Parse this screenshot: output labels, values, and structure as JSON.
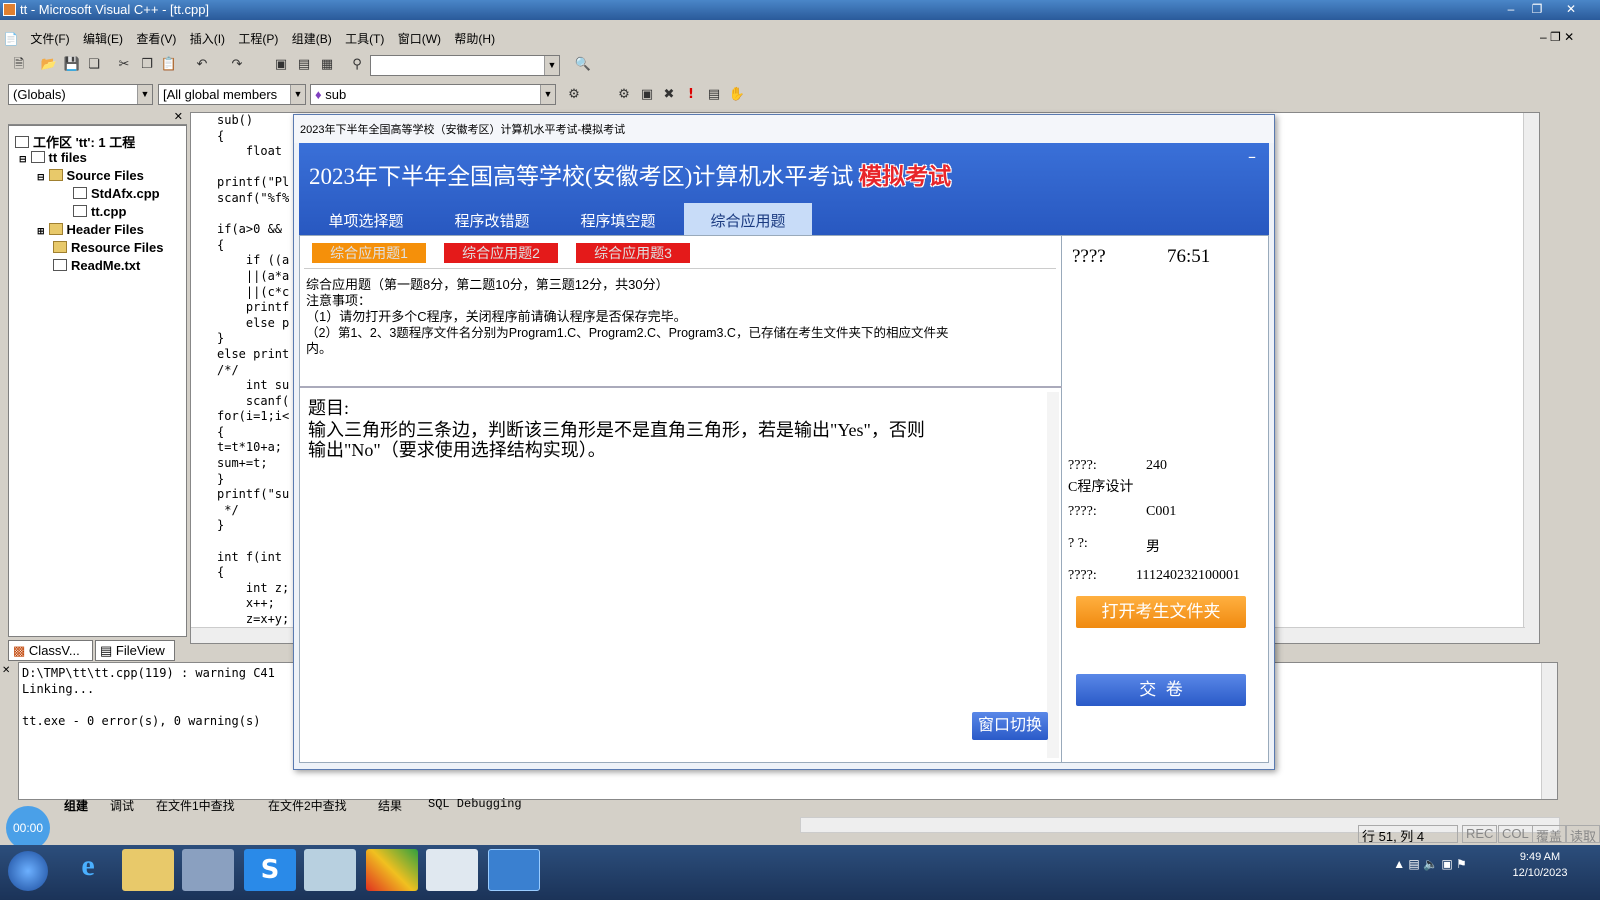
{
  "window": {
    "title": "tt - Microsoft Visual C++ - [tt.cpp]"
  },
  "menu": [
    "文件(F)",
    "编辑(E)",
    "查看(V)",
    "插入(I)",
    "工程(P)",
    "组建(B)",
    "工具(T)",
    "窗口(W)",
    "帮助(H)"
  ],
  "combos": {
    "globals": "(Globals)",
    "members": "[All global members",
    "func": "sub"
  },
  "workspace": {
    "root": "工作区 'tt': 1 工程",
    "project": "tt files",
    "source": "Source Files",
    "file1": "StdAfx.cpp",
    "file2": "tt.cpp",
    "header": "Header Files",
    "resource": "Resource Files",
    "readme": "ReadMe.txt",
    "tab_class": "ClassV...",
    "tab_file": "FileView"
  },
  "code_lines": [
    "sub()",
    "{",
    "    float",
    "",
    "printf(\"Pl",
    "scanf(\"%f%",
    "",
    "if(a>0 &&",
    "{",
    "    if ((a",
    "    ||(a*a",
    "    ||(c*c",
    "    printf",
    "    else p",
    "}",
    "else print",
    "/*/",
    "    int su",
    "    scanf(",
    "for(i=1;i<",
    "{",
    "t=t*10+a;",
    "sum+=t;",
    "}",
    "printf(\"su",
    " */",
    "}",
    "",
    "int f(int",
    "{",
    "    int z;",
    "    x++;",
    "    z=x+y;",
    "    y++;"
  ],
  "output_lines": [
    "D:\\TMP\\tt\\tt.cpp(119) : warning C41",
    "Linking...",
    "",
    "tt.exe - 0 error(s), 0 warning(s)"
  ],
  "bottom_tabs": [
    "组建",
    "调试",
    "在文件1中查找",
    "在文件2中查找",
    "结果",
    "SQL Debugging"
  ],
  "status": {
    "pos": "行 51, 列 4",
    "rec": "REC",
    "col": "COL",
    "ovr": "覆盖",
    "read": "读取"
  },
  "dialog": {
    "title": "2023年下半年全国高等学校（安徽考区）计算机水平考试-模拟考试",
    "banner_title": "2023年下半年全国高等学校(安徽考区)计算机水平考试",
    "banner_mock": "模拟考试",
    "tabs": [
      "单项选择题",
      "程序改错题",
      "程序填空题",
      "综合应用题"
    ],
    "subtabs": [
      "综合应用题1",
      "综合应用题2",
      "综合应用题3"
    ],
    "notes": [
      "综合应用题（第一题8分，第二题10分，第三题12分，共30分）",
      "注意事项：",
      "（1）请勿打开多个C程序，关闭程序前请确认程序是否保存完毕。",
      "（2）第1、2、3题程序文件名分别为Program1.C、Program2.C、Program3.C，已存储在考生文件夹下的相应文件夹",
      "内。"
    ],
    "question": [
      "题目:",
      "输入三角形的三条边，判断该三角形是不是直角三角形，若是输出\"Yes\"，否则",
      "输出\"No\"（要求使用选择结构实现）。"
    ],
    "switch_btn": "窗口切换",
    "timer_label": "????",
    "timer_value": "76:51",
    "info": [
      {
        "label": "????:",
        "value": "240"
      },
      {
        "label": "C程序设计",
        "value": ""
      },
      {
        "label": "????:",
        "value": "C001"
      },
      {
        "label": "?   ?:",
        "value": "男"
      },
      {
        "label": "????:",
        "value": "111240232100001"
      }
    ],
    "open_folder_btn": "打开考生文件夹",
    "submit_btn": "交  卷"
  },
  "timer_overlay": "00:00",
  "taskbar": {
    "time": "9:49 AM",
    "date": "12/10/2023"
  }
}
